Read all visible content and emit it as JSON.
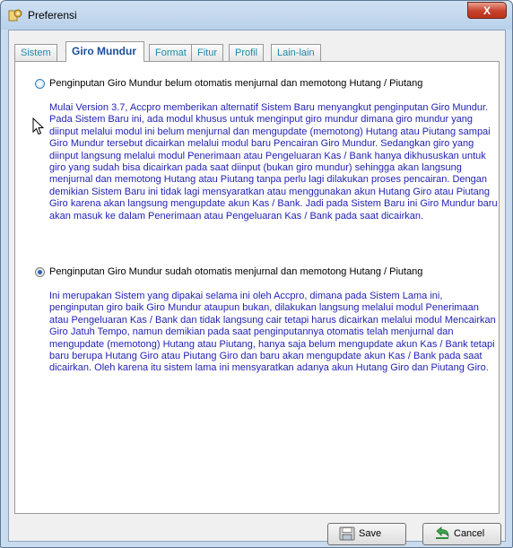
{
  "window": {
    "title": "Preferensi",
    "close_glyph": "X"
  },
  "tabs": [
    {
      "label": "Sistem",
      "active": false
    },
    {
      "label": "Giro Mundur",
      "active": true
    },
    {
      "label": "Format",
      "active": false
    },
    {
      "label": "Fitur",
      "active": false
    },
    {
      "label": "Profil",
      "active": false
    },
    {
      "label": "Lain-lain",
      "active": false
    }
  ],
  "options": [
    {
      "label": "Penginputan Giro Mundur belum otomatis menjurnal dan memotong Hutang / Piutang",
      "selected": false,
      "description": "Mulai Version 3.7, Accpro memberikan alternatif Sistem Baru menyangkut penginputan Giro Mundur. Pada Sistem Baru ini, ada modul khusus untuk menginput giro mundur dimana giro mundur yang diinput melalui modul ini belum menjurnal dan mengupdate (memotong) Hutang atau Piutang sampai Giro Mundur tersebut dicairkan melalui modul baru Pencairan Giro Mundur. Sedangkan giro yang diinput langsung melalui modul Penerimaan atau Pengeluaran Kas / Bank hanya dikhususkan untuk giro yang sudah bisa dicairkan pada saat diinput (bukan giro mundur) sehingga akan langsung menjurnal dan memotong Hutang atau Piutang tanpa perlu lagi dilakukan proses pencairan. Dengan demikian Sistem Baru ini tidak lagi mensyaratkan atau menggunakan akun Hutang Giro atau Piutang Giro karena akan langsung mengupdate akun Kas / Bank. Jadi pada Sistem Baru ini Giro Mundur baru akan masuk ke dalam Penerimaan atau Pengeluaran Kas / Bank pada saat dicairkan."
    },
    {
      "label": "Penginputan Giro Mundur sudah otomatis menjurnal dan memotong Hutang / Piutang",
      "selected": true,
      "description": "Ini merupakan Sistem yang dipakai selama ini oleh Accpro, dimana pada Sistem Lama ini, penginputan giro baik Giro Mundur ataupun bukan, dilakukan langsung melalui modul Penerimaan atau Pengeluaran Kas / Bank dan tidak langsung cair tetapi harus dicairkan melalui modul Mencairkan Giro Jatuh Tempo, namun demikian pada saat penginputannya otomatis telah menjurnal dan mengupdate (memotong) Hutang atau Piutang, hanya saja belum mengupdate akun Kas / Bank tetapi baru berupa Hutang Giro atau Piutang Giro dan baru akan mengupdate akun Kas / Bank pada saat dicairkan. Oleh karena itu sistem lama ini mensyaratkan adanya akun Hutang Giro dan Piutang Giro."
    }
  ],
  "buttons": {
    "save": {
      "label": "Save",
      "icon": "floppy-disk-icon"
    },
    "cancel": {
      "label": "Cancel",
      "icon": "undo-arrow-icon"
    }
  },
  "colors": {
    "description_text": "#1f1fb5",
    "active_tab_text": "#1a4d9b",
    "tab_text": "#1d8aa8"
  }
}
